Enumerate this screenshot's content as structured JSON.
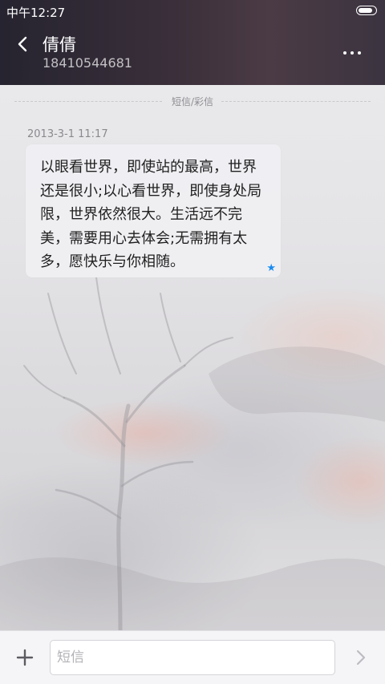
{
  "status_bar": {
    "time": "中午12:27",
    "battery_level": 0.9
  },
  "header": {
    "back_icon": "chevron-left-icon",
    "contact_name": "倩倩",
    "phone_number": "18410544681",
    "more_icon": "more-dots-icon"
  },
  "thread": {
    "divider_label": "短信/彩信",
    "messages": [
      {
        "timestamp": "2013-3-1 11:17",
        "text": "以眼看世界，即使站的最高，世界还是很小;以心看世界，即使身处局限，世界依然很大。生活远不完美，需要用心去体会;无需拥有太多，愿快乐与你相随。",
        "starred": true,
        "star_glyph": "★",
        "star_color": "#1a8cf0"
      }
    ]
  },
  "composer": {
    "add_icon": "plus-icon",
    "input_value": "",
    "input_placeholder": "短信",
    "send_icon": "chevron-right-icon"
  }
}
